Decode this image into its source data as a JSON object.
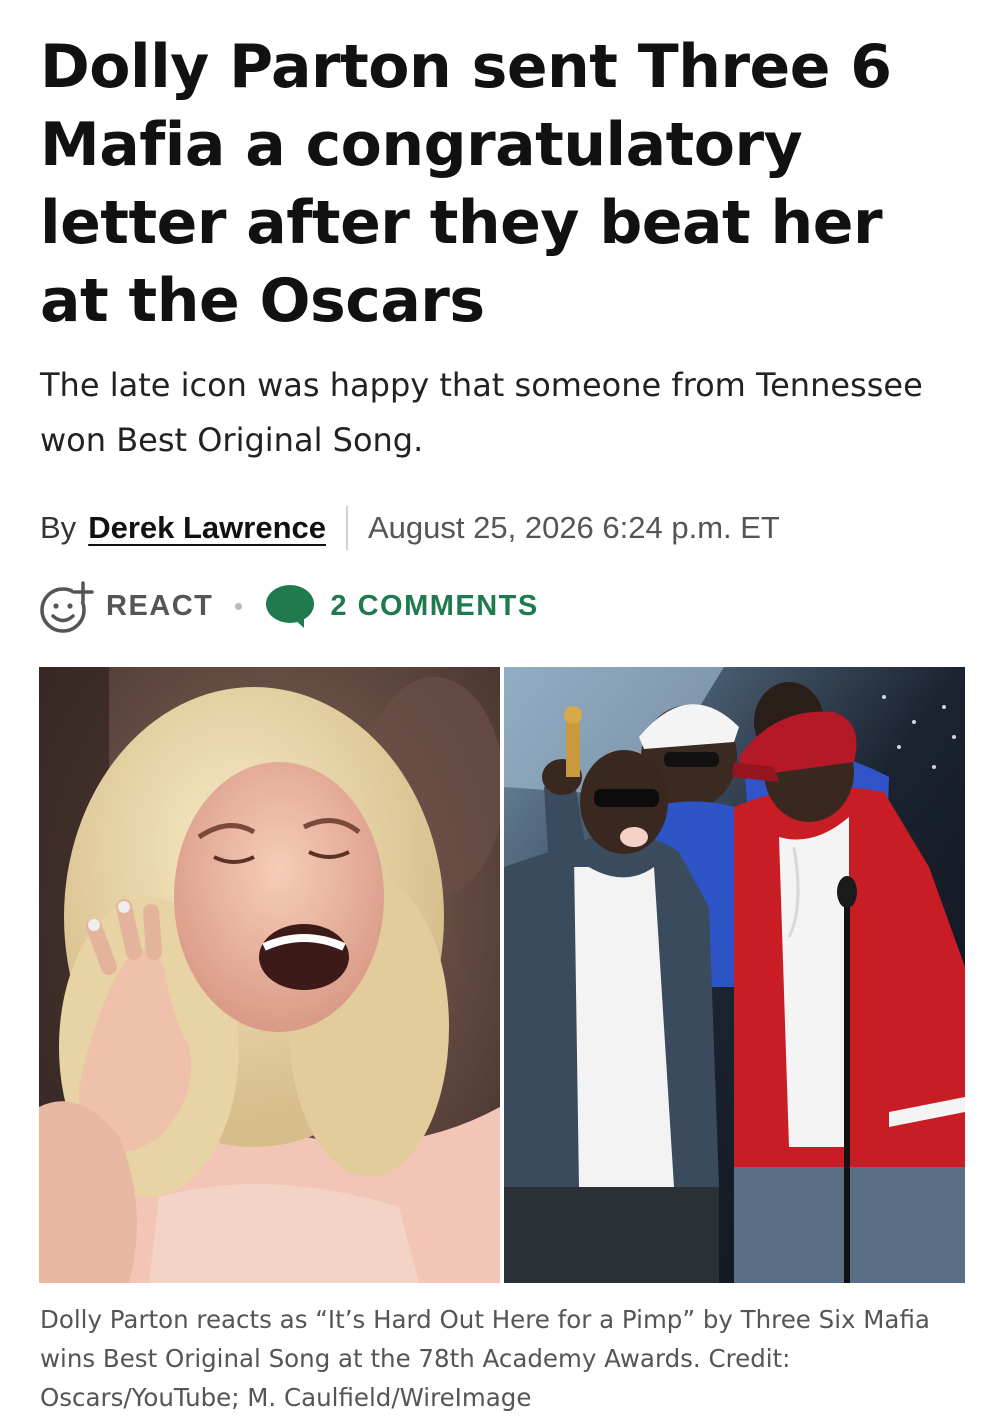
{
  "article": {
    "headline": "Dolly Parton sent Three 6 Mafia a congratulatory letter after they beat her at the Oscars",
    "dek": "The late icon was happy that someone from Tennessee won Best Original Song.",
    "byline": {
      "prefix": "By",
      "author": "Derek Lawrence",
      "date": "August 25, 2026 6:24 p.m. ET"
    },
    "actions": {
      "react_label": "REACT",
      "comments_label": "2 COMMENTS"
    },
    "caption": "Dolly Parton reacts as “It’s Hard Out Here for a Pimp” by Three Six Mafia wins Best Original Song at the 78th Academy Awards. Credit: Oscars/YouTube; M. Caulfield/WireImage"
  },
  "colors": {
    "text": "#111111",
    "muted": "#555555",
    "comments_accent": "#1f7a4d",
    "background": "#ffffff"
  },
  "icons": {
    "react": "smiley-plus-icon",
    "comments": "speech-bubble-icon"
  }
}
